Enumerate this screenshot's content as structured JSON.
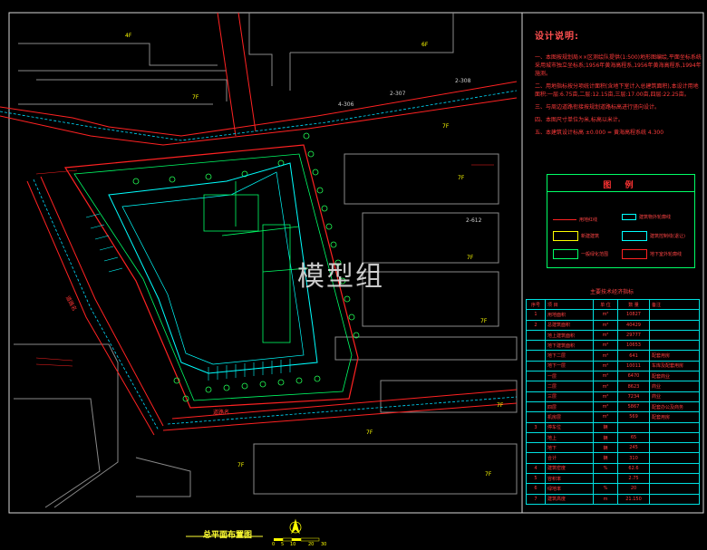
{
  "notes": {
    "heading": "设计说明:",
    "items": [
      "一、本图按规划局××区测绘队提供(1:500)地形图编绘,平面坐标系统采用城市独立坐标系;1956年黄海高程系,1956年黄海高程系,1994年施测。",
      "二、用地指标按分项统计面积(含地下室计入总建筑面积),本设计用地面积:一层:6.75亩,二层:12.15亩,三层:17.00亩,四层:22.25亩。",
      "三、与周边道路衔接按规划道路标高进行竖向设计。",
      "四、本图尺寸单位为米,标高以米计。",
      "五、本建筑设计标高 ±0.000 = 黄海高程系统 4.300"
    ]
  },
  "legend": {
    "title": "图 例",
    "items": [
      {
        "label": "用地红线",
        "color": "#ff2222"
      },
      {
        "label": "建筑物外轮廓线",
        "color": "#00ffff"
      },
      {
        "label": "新建建筑",
        "color": "#ffff00"
      },
      {
        "label": "建筑控制线(退让)",
        "color": "#00ffff"
      },
      {
        "label": "一般绿化范围",
        "color": "#00ff66"
      },
      {
        "label": "地下室外轮廓线",
        "color": "#ff2222"
      }
    ]
  },
  "table": {
    "title": "主要技术经济指标",
    "header": [
      "序号",
      "项 目",
      "单 位",
      "数 量",
      "备注"
    ],
    "rows": [
      [
        "1",
        "用地面积",
        "m²",
        "10827",
        ""
      ],
      [
        "2",
        "总建筑面积",
        "m²",
        "40429",
        ""
      ],
      [
        "",
        "地上建筑面积",
        "m²",
        "29777",
        ""
      ],
      [
        "",
        "地下建筑面积",
        "m²",
        "10653",
        ""
      ],
      [
        "",
        "地下二层",
        "m²",
        "641",
        "配套用房"
      ],
      [
        "",
        "地下一层",
        "m²",
        "10011",
        "车库及配套用房"
      ],
      [
        "",
        "一层",
        "m²",
        "6470",
        "配套商业"
      ],
      [
        "",
        "二层",
        "m²",
        "8623",
        "商业"
      ],
      [
        "",
        "三层",
        "m²",
        "7234",
        "商业"
      ],
      [
        "",
        "四层",
        "m²",
        "5867",
        "配套办公及商务"
      ],
      [
        "",
        "机房层",
        "m²",
        "569",
        "配套用房"
      ],
      [
        "3",
        "停车位",
        "辆",
        "",
        ""
      ],
      [
        "",
        "地上",
        "辆",
        "65",
        ""
      ],
      [
        "",
        "地下",
        "辆",
        "245",
        ""
      ],
      [
        "",
        "合计",
        "辆",
        "310",
        ""
      ],
      [
        "4",
        "建筑密度",
        "%",
        "62.6",
        ""
      ],
      [
        "5",
        "容积率",
        "",
        "2.75",
        ""
      ],
      [
        "6",
        "绿地率",
        "%",
        "20",
        ""
      ],
      [
        "7",
        "建筑高度",
        "m",
        "21.150",
        ""
      ]
    ]
  },
  "map": {
    "floor_labels": [
      "4F",
      "6F",
      "7F",
      "7F",
      "7F",
      "7F",
      "7F",
      "7F",
      "7F",
      "7F",
      "7F"
    ],
    "plot_labels": [
      "4-306",
      "2-307",
      "2-308",
      "2-612"
    ],
    "street_left": "道路名",
    "street_bottom": "道路名"
  },
  "watermark": "模型组",
  "drawing_title": "总平面布置图",
  "scale": {
    "ticks": [
      "0",
      "5",
      "10",
      "20",
      "30"
    ]
  }
}
